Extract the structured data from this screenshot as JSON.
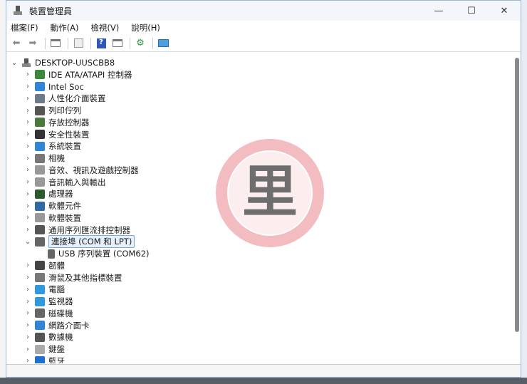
{
  "window": {
    "title": "裝置管理員",
    "minimize": "—",
    "maximize": "☐",
    "close": "✕"
  },
  "menu": [
    "檔案(F)",
    "動作(A)",
    "檢視(V)",
    "說明(H)"
  ],
  "toolbar": [
    "back",
    "forward",
    "properties",
    "update",
    "help",
    "show-hidden",
    "scan",
    "monitor"
  ],
  "tree": {
    "root": "DESKTOP-UUSCBB8",
    "items": [
      {
        "label": "IDE ATA/ATAPI 控制器",
        "color": "#3a8a3a"
      },
      {
        "label": "Intel Soc",
        "color": "#2f86d6"
      },
      {
        "label": "人性化介面裝置",
        "color": "#6b7a8c"
      },
      {
        "label": "列印佇列",
        "color": "#555"
      },
      {
        "label": "存放控制器",
        "color": "#4a7a3a"
      },
      {
        "label": "安全性裝置",
        "color": "#333"
      },
      {
        "label": "系統裝置",
        "color": "#2f86d6"
      },
      {
        "label": "相機",
        "color": "#777"
      },
      {
        "label": "音效、視訊及遊戲控制器",
        "color": "#999"
      },
      {
        "label": "音訊輸入與輸出",
        "color": "#999"
      },
      {
        "label": "處理器",
        "color": "#2d5a2d"
      },
      {
        "label": "軟體元件",
        "color": "#2f6aa6"
      },
      {
        "label": "軟體裝置",
        "color": "#999"
      },
      {
        "label": "通用序列匯流排控制器",
        "color": "#555"
      },
      {
        "label": "連接埠 (COM 和 LPT)",
        "color": "#666",
        "expanded": true,
        "children": [
          "USB 序列裝置 (COM62)"
        ]
      },
      {
        "label": "韌體",
        "color": "#444"
      },
      {
        "label": "滑鼠及其他指標裝置",
        "color": "#777"
      },
      {
        "label": "電腦",
        "color": "#2f9ae0"
      },
      {
        "label": "監視器",
        "color": "#2f9ae0"
      },
      {
        "label": "磁碟機",
        "color": "#666"
      },
      {
        "label": "網路介面卡",
        "color": "#2f86d6"
      },
      {
        "label": "數據機",
        "color": "#555"
      },
      {
        "label": "鍵盤",
        "color": "#aaa"
      },
      {
        "label": "藍牙",
        "color": "#1e6fd0"
      }
    ]
  },
  "watermark": "里"
}
